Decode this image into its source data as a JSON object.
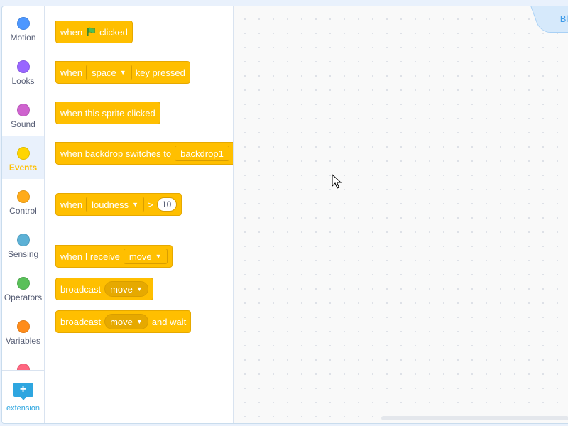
{
  "categories": [
    {
      "label": "Motion",
      "color": "#4c97ff"
    },
    {
      "label": "Looks",
      "color": "#9966ff"
    },
    {
      "label": "Sound",
      "color": "#cf63cf"
    },
    {
      "label": "Events",
      "color": "#ffd500",
      "active": true
    },
    {
      "label": "Control",
      "color": "#ffab19"
    },
    {
      "label": "Sensing",
      "color": "#5cb1d6"
    },
    {
      "label": "Operators",
      "color": "#59c059"
    },
    {
      "label": "Variables",
      "color": "#ff8c1a"
    },
    {
      "label": "",
      "color": "#ff6680"
    }
  ],
  "extension": {
    "label": "extension",
    "icon": "add-extension-icon",
    "color": "#2ea6e0"
  },
  "blocks": {
    "flag_clicked": {
      "before": "when",
      "after": "clicked",
      "icon": "green-flag-icon"
    },
    "key_pressed": {
      "before": "when",
      "dropdown": "space",
      "after": "key pressed"
    },
    "sprite_clicked": {
      "text": "when this sprite clicked"
    },
    "backdrop": {
      "before": "when backdrop switches to",
      "dropdown": "backdrop1"
    },
    "loudness": {
      "before": "when",
      "dropdown": "loudness",
      "operator": ">",
      "value": "10"
    },
    "receive": {
      "before": "when I receive",
      "dropdown": "move"
    },
    "broadcast": {
      "before": "broadcast",
      "dropdown": "move"
    },
    "broadcast_wait": {
      "before": "broadcast",
      "dropdown": "move",
      "after": "and wait"
    }
  },
  "workspace": {
    "tab_label": "Blo"
  },
  "colors": {
    "events": "#ffbf00",
    "events_border": "#e6a900",
    "accent": "#2ea6e0"
  }
}
